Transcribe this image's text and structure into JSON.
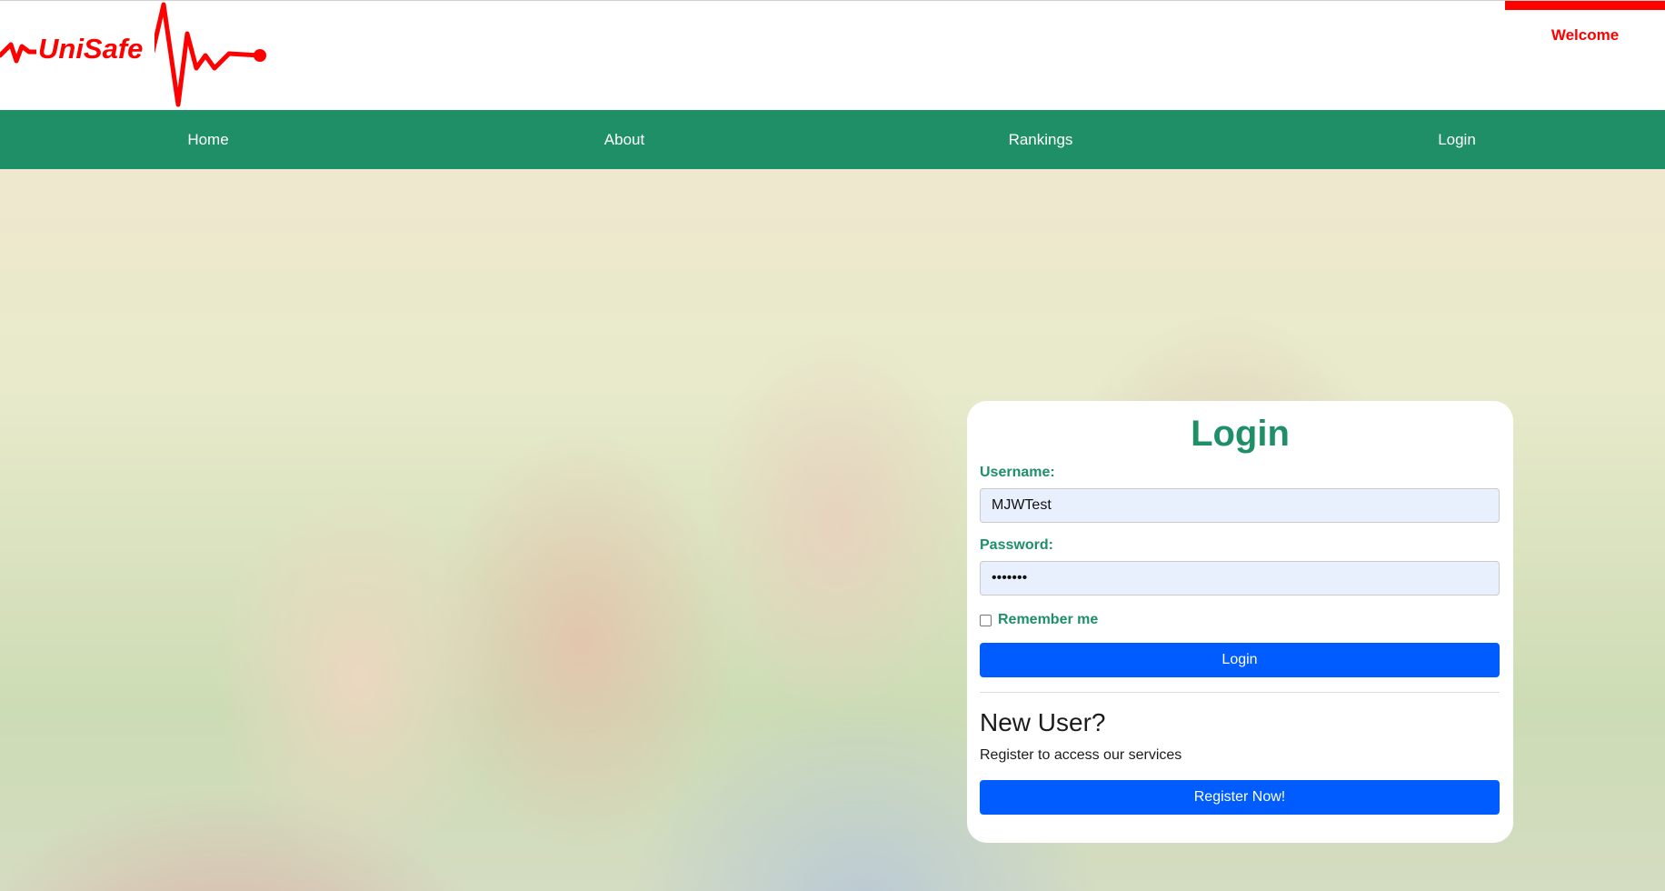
{
  "brand": {
    "name": "UniSafe",
    "color": "#ff0000"
  },
  "header": {
    "welcome": "Welcome"
  },
  "nav": {
    "color": "#1f8f67",
    "items": [
      {
        "label": "Home"
      },
      {
        "label": "About"
      },
      {
        "label": "Rankings"
      },
      {
        "label": "Login"
      }
    ]
  },
  "hero": {
    "image": "students-photo"
  },
  "login_form": {
    "title": "Login",
    "username_label": "Username:",
    "username_value": "MJWTest",
    "password_label": "Password:",
    "password_value": "•••••••",
    "remember_label": "Remember me",
    "remember_checked": false,
    "submit_label": "Login",
    "accent": "#005cff"
  },
  "register": {
    "title": "New User?",
    "subtitle": "Register to access our services",
    "button_label": "Register Now!"
  }
}
